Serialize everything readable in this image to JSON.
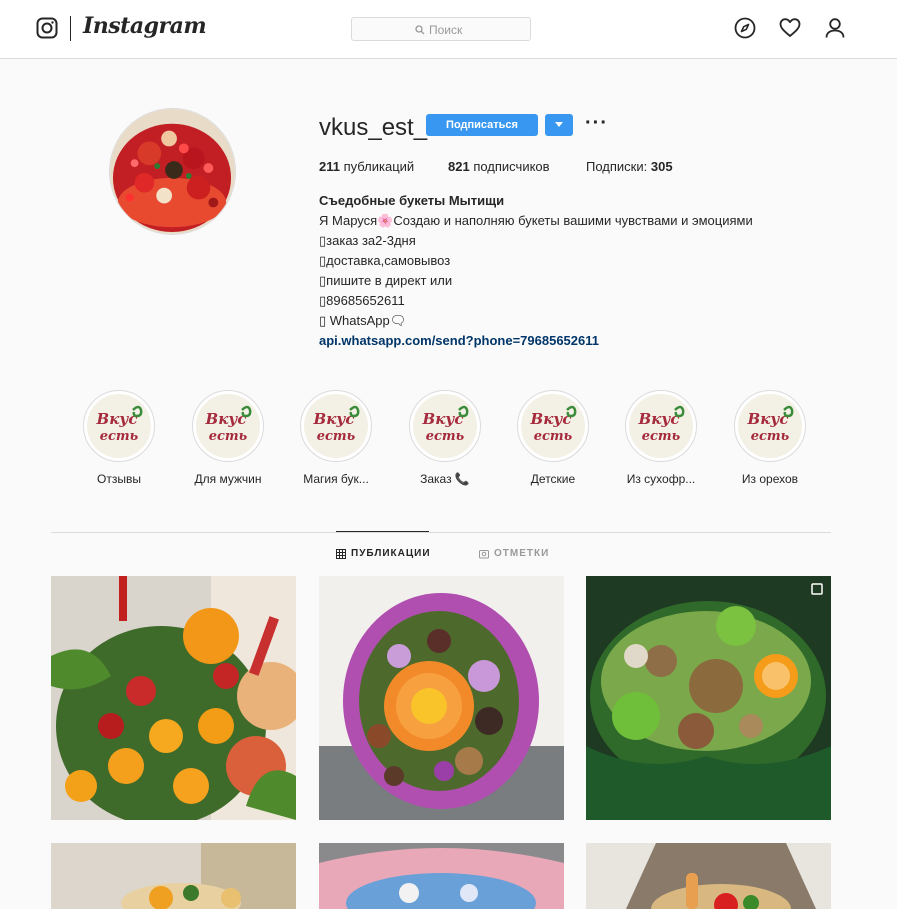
{
  "nav": {
    "wordmark": "Instagram",
    "search_placeholder": "Поиск",
    "icons": [
      "instagram-icon",
      "explore-icon",
      "heart-icon",
      "profile-icon"
    ]
  },
  "profile": {
    "username": "vkus_est_",
    "follow_label": "Подписаться",
    "stats": {
      "posts_count": "211",
      "posts_label": " публикаций",
      "followers_count": "821",
      "followers_label": " подписчиков",
      "following_label": "Подписки: ",
      "following_count": "305"
    },
    "full_name": "Съедобные букеты Мытищи",
    "bio": [
      "Я Маруся🌸Создаю и наполняю букеты вашими чувствами и эмоциями",
      "▯заказ за2-3дня",
      "▯доставка,самовывоз",
      "▯пишите в директ или",
      "▯89685652611",
      "▯ WhatsApp🗨"
    ],
    "link": "api.whatsapp.com/send?phone=79685652611"
  },
  "highlights": [
    {
      "label": "Отзывы"
    },
    {
      "label": "Для мужчин"
    },
    {
      "label": "Магия бук..."
    },
    {
      "label": "Заказ 📞"
    },
    {
      "label": "Детские"
    },
    {
      "label": "Из сухофр..."
    },
    {
      "label": "Из орехов"
    }
  ],
  "highlight_logo": {
    "line1": "Вкус",
    "line2": "есть"
  },
  "tabs": [
    {
      "label": "ПУБЛИКАЦИИ",
      "active": true
    },
    {
      "label": "ОТМЕТКИ",
      "active": false
    }
  ],
  "colors": {
    "accent": "#3897f0",
    "link": "#003569",
    "logo_red": "#a52a3c",
    "logo_green": "#3a8c3a"
  }
}
